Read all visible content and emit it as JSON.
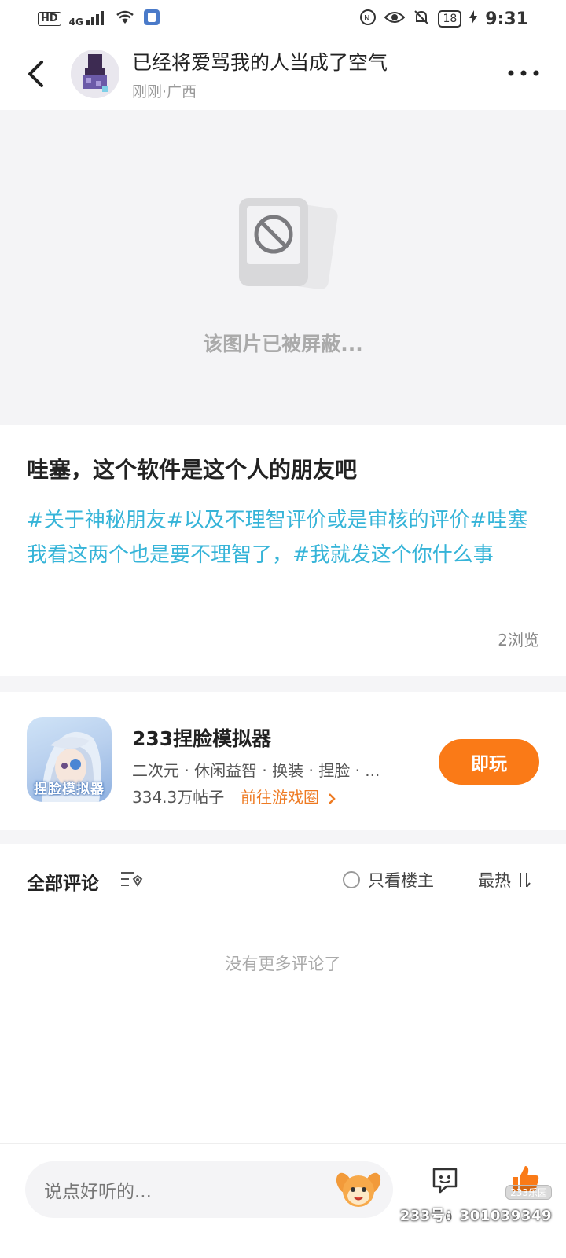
{
  "status_bar": {
    "network": "HD",
    "signal": "4G",
    "battery": "18",
    "time": "9:31"
  },
  "header": {
    "title": "已经将爱骂我的人当成了空气",
    "subtitle": "刚刚·广西"
  },
  "blocked_image": {
    "text": "该图片已被屏蔽..."
  },
  "post": {
    "title": "哇塞，这个软件是这个人的朋友吧",
    "tags_text": "#关于神秘朋友#以及不理智评价或是审核的评价#哇塞我看这两个也是要不理智了，#我就发这个你什么事",
    "views": "2浏览"
  },
  "game_card": {
    "name": "233捏脸模拟器",
    "tags": "二次元 · 休闲益智 · 换装 · 捏脸 · ...",
    "posts": "334.3万帖子",
    "link": "前往游戏圈",
    "play_label": "即玩",
    "icon_label": "捏脸模拟器",
    "accent": "#fa7a17"
  },
  "comments": {
    "title": "全部评论",
    "owner_only": "只看楼主",
    "sort": "最热",
    "empty": "没有更多评论了"
  },
  "bottom_bar": {
    "placeholder": "说点好听的...",
    "chat_count": "0",
    "watermark_badge": "233乐园",
    "watermark": "233号：301039349"
  }
}
